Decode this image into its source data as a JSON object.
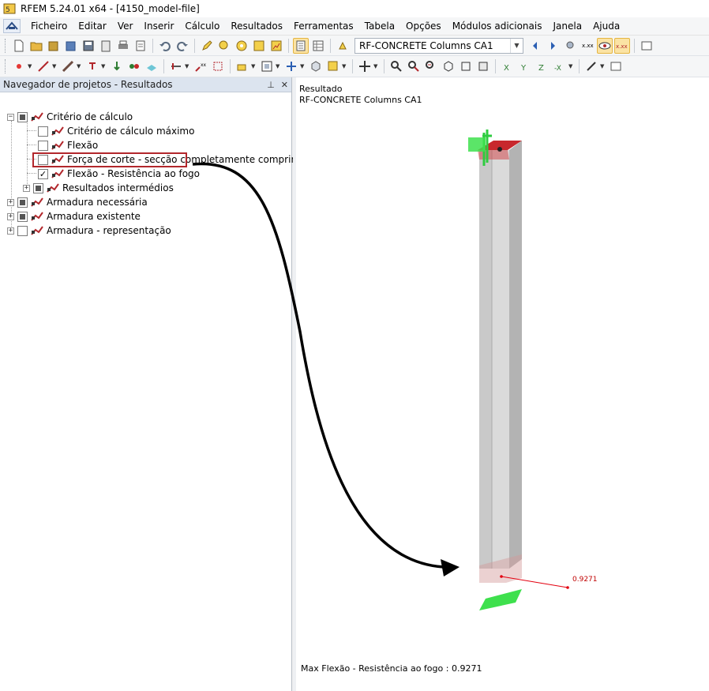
{
  "window": {
    "title": "RFEM 5.24.01 x64 - [4150_model-file]"
  },
  "menu": {
    "items": [
      {
        "label": "Ficheiro"
      },
      {
        "label": "Editar"
      },
      {
        "label": "Ver"
      },
      {
        "label": "Inserir"
      },
      {
        "label": "Cálculo"
      },
      {
        "label": "Resultados"
      },
      {
        "label": "Ferramentas"
      },
      {
        "label": "Tabela"
      },
      {
        "label": "Opções"
      },
      {
        "label": "Módulos adicionais"
      },
      {
        "label": "Janela"
      },
      {
        "label": "Ajuda"
      }
    ]
  },
  "toolbar": {
    "case_select_value": "RF-CONCRETE Columns CA1",
    "active_color": "#fbe3a4"
  },
  "navigator": {
    "title": "Navegador de projetos - Resultados",
    "pin_icon": "pin-icon",
    "close_icon": "close-icon",
    "tree": [
      {
        "label": "Critério de cálculo",
        "level": 0,
        "expander": "−",
        "state": "partial"
      },
      {
        "label": "Critério de cálculo máximo",
        "level": 1,
        "expander": "",
        "state": "unchecked"
      },
      {
        "label": "Flexão",
        "level": 1,
        "expander": "",
        "state": "unchecked"
      },
      {
        "label": "Força de corte - secção completamente comprimida",
        "level": 1,
        "expander": "",
        "state": "unchecked"
      },
      {
        "label": "Flexão - Resistência ao fogo",
        "level": 1,
        "expander": "",
        "state": "checked"
      },
      {
        "label": "Resultados intermédios",
        "level": 1,
        "expander": "+",
        "state": "partial"
      },
      {
        "label": "Armadura necessária",
        "level": 0,
        "expander": "+",
        "state": "partial"
      },
      {
        "label": "Armadura existente",
        "level": 0,
        "expander": "+",
        "state": "partial"
      },
      {
        "label": "Armadura - representação",
        "level": 0,
        "expander": "+",
        "state": "unchecked"
      }
    ],
    "highlight_color": "#b2272c"
  },
  "viewport": {
    "result_label": "Resultado",
    "case_label": "RF-CONCRETE Columns CA1",
    "value_label": "0.9271",
    "footer": "Max Flexão - Resistência ao fogo : 0.9271",
    "colors": {
      "column_face_front": "#d2d2d2",
      "column_face_side": "#b9b9b9",
      "top_face": "#c8282d",
      "support": "#3ee04d",
      "dimension_line": "#e3000f"
    }
  }
}
